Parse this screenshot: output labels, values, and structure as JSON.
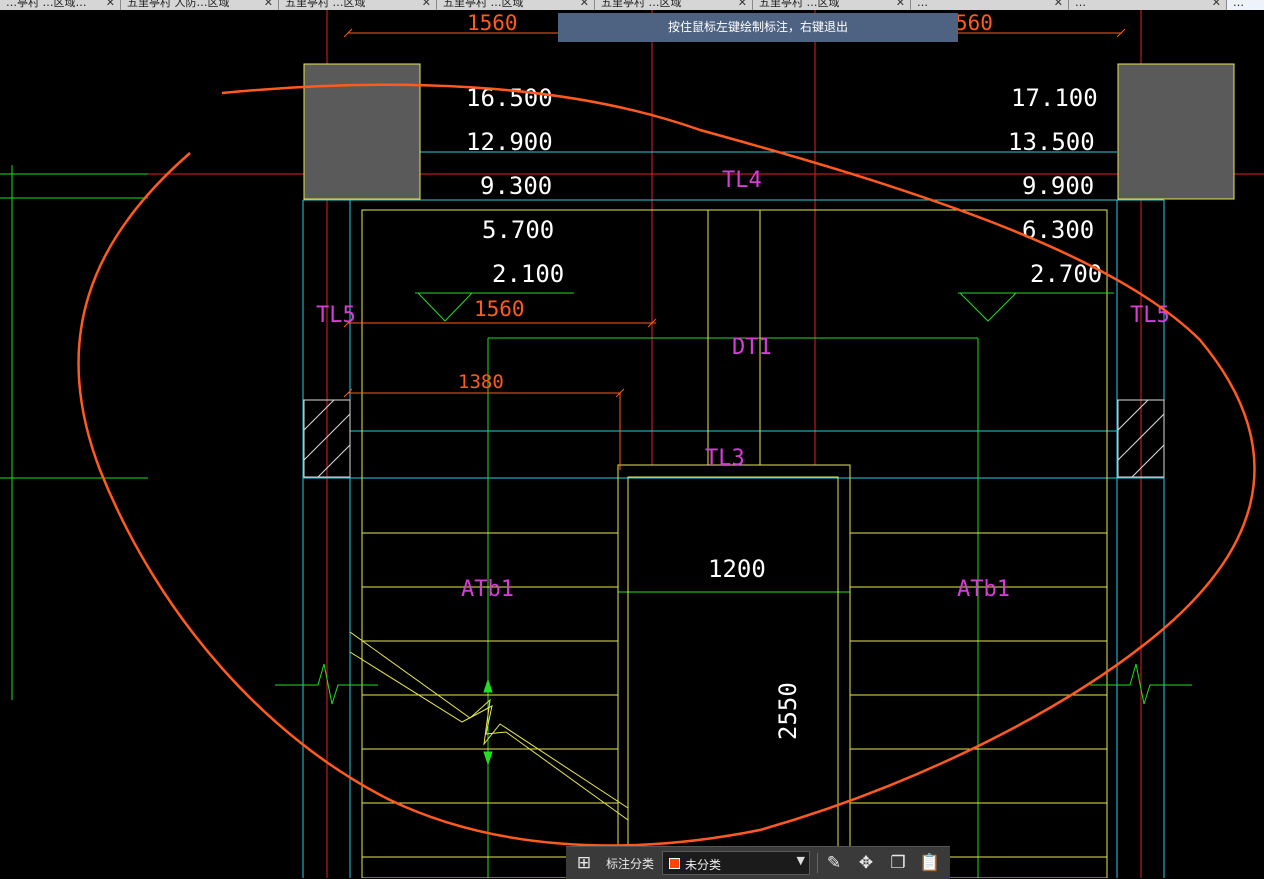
{
  "tabs": [
    {
      "label": "…亭村 …区域…"
    },
    {
      "label": "五里亭村 人防…区域"
    },
    {
      "label": "五里亭村 …区域"
    },
    {
      "label": "五里亭村 …区域"
    },
    {
      "label": "五里亭村 …区域"
    },
    {
      "label": "五里亭村 …区域"
    },
    {
      "label": "…"
    },
    {
      "label": "…"
    },
    {
      "label": "…"
    }
  ],
  "hint": "按住鼠标左键绘制标注，右键退出",
  "toolbar": {
    "category_label": "标注分类",
    "category_value": "未分类",
    "category_swatch": "#ff4500"
  },
  "drawing": {
    "dims": {
      "top_left": "1560",
      "top_right": "560",
      "mid_1560": "1560",
      "mid_1380": "1380",
      "width_1200": "1200",
      "height_2550": "2550"
    },
    "elevations_left": [
      "16.500",
      "12.900",
      "9.300",
      "5.700",
      "2.100"
    ],
    "elevations_right": [
      "17.100",
      "13.500",
      "9.900",
      "6.300",
      "2.700"
    ],
    "labels": {
      "tl4": "TL4",
      "tl5_left": "TL5",
      "tl5_right": "TL5",
      "dt1": "DT1",
      "tl3": "TL3",
      "atb1_left": "ATb1",
      "atb1_right": "ATb1"
    }
  }
}
